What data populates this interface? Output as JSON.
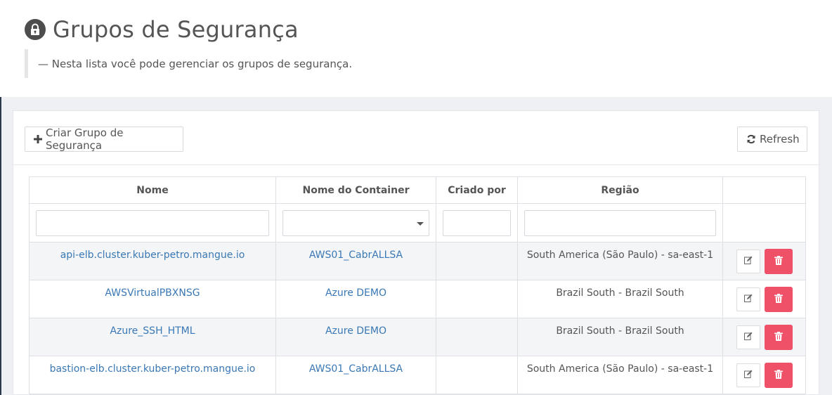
{
  "page": {
    "title": "Grupos de Segurança",
    "subtitle": "— Nesta lista você pode gerenciar os grupos de segurança."
  },
  "toolbar": {
    "create_label": "Criar Grupo de Segurança",
    "refresh_label": "Refresh"
  },
  "table": {
    "columns": [
      "Nome",
      "Nome do Container",
      "Criado por",
      "Região",
      ""
    ],
    "filters": {
      "nome": "",
      "container": "",
      "criado_por": "",
      "regiao": ""
    },
    "rows": [
      {
        "nome": "api-elb.cluster.kuber-petro.mangue.io",
        "container": "AWS01_CabrALLSA",
        "criado_por": "",
        "regiao": "South America (São Paulo) - sa-east-1"
      },
      {
        "nome": "AWSVirtualPBXNSG",
        "container": "Azure DEMO",
        "criado_por": "",
        "regiao": "Brazil South - Brazil South"
      },
      {
        "nome": "Azure_SSH_HTML",
        "container": "Azure DEMO",
        "criado_por": "",
        "regiao": "Brazil South - Brazil South"
      },
      {
        "nome": "bastion-elb.cluster.kuber-petro.mangue.io",
        "container": "AWS01_CabrALLSA",
        "criado_por": "",
        "regiao": "South America (São Paulo) - sa-east-1"
      }
    ]
  },
  "icons": {
    "title": "lock-icon",
    "create": "plus-icon",
    "refresh": "refresh-icon",
    "edit": "edit-icon",
    "delete": "trash-icon"
  },
  "colors": {
    "link": "#3a78b5",
    "danger": "#ee5168",
    "stripe": "#f4f5f7",
    "background": "#eef0f3"
  }
}
